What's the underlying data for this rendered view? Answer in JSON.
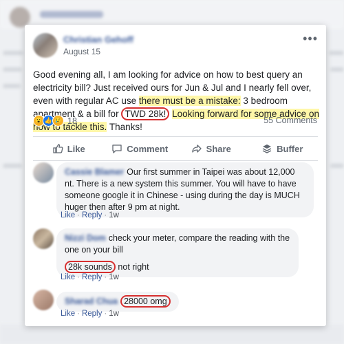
{
  "post": {
    "author": "Christian Gehoff",
    "time": "August 15",
    "text_a": "Good evening all, I am looking for advice on how to best query an electricity bill? Just received ours for Jun & Jul and I nearly fell over, even with regular AC use ",
    "text_hl1": "there must be a mistake:",
    "text_b": " 3 bedroom apartment & a bill for ",
    "text_circ": "TWD 28k!",
    "text_c": " ",
    "text_hl2": "Looking forward for some advice on how to tackle this.",
    "text_d": " Thanks!",
    "reaction_count": "18",
    "comments_count": "55 Comments"
  },
  "actions": {
    "like": "Like",
    "comment": "Comment",
    "share": "Share",
    "buffer": "Buffer"
  },
  "comments": [
    {
      "name": "Cassie Blamer",
      "text": "Our first summer in Taipei was about 12,000 nt. There is a new system this summer. You will have to have someone google it in Chinese - using during the day is MUCH huger then after 9 pm at night.",
      "like": "Like",
      "reply": "Reply",
      "age": "1w"
    },
    {
      "name": "Nizzi Dom",
      "text": "check your meter, compare the reading with the one on your bill",
      "line2_circ": "28k sounds",
      "line2_rest": " not right",
      "like": "Like",
      "reply": "Reply",
      "age": "1w"
    },
    {
      "name": "Sharad Chua",
      "text": "28000 omg",
      "like": "Like",
      "reply": "Reply",
      "age": "1w"
    }
  ],
  "icons": {
    "more": "more-icon",
    "like": "thumbs-up-icon",
    "comment": "speech-bubble-icon",
    "share": "share-arrow-icon",
    "buffer": "buffer-stack-icon"
  },
  "colors": {
    "link": "#385898",
    "highlight": "#fff7a8",
    "annotation": "#d62f2f"
  }
}
